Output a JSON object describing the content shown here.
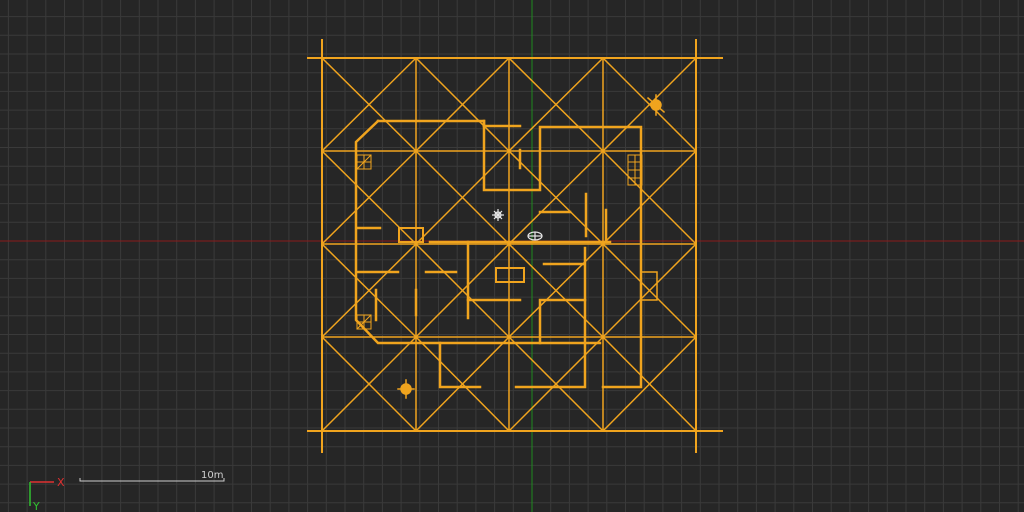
{
  "viewport": {
    "background": "#262626",
    "grid_color": "#3a3a3a",
    "x_axis_color": "#8b1a1a",
    "y_axis_color": "#1f8a1f"
  },
  "plan": {
    "line_color": "#f0a41e",
    "object_icon_color": "#e8e8e8"
  },
  "scale_bar": {
    "label": "10m"
  },
  "axes_gizmo": {
    "x_label": "X",
    "y_label": "Y",
    "x_color": "#e03030",
    "y_color": "#30c030"
  }
}
